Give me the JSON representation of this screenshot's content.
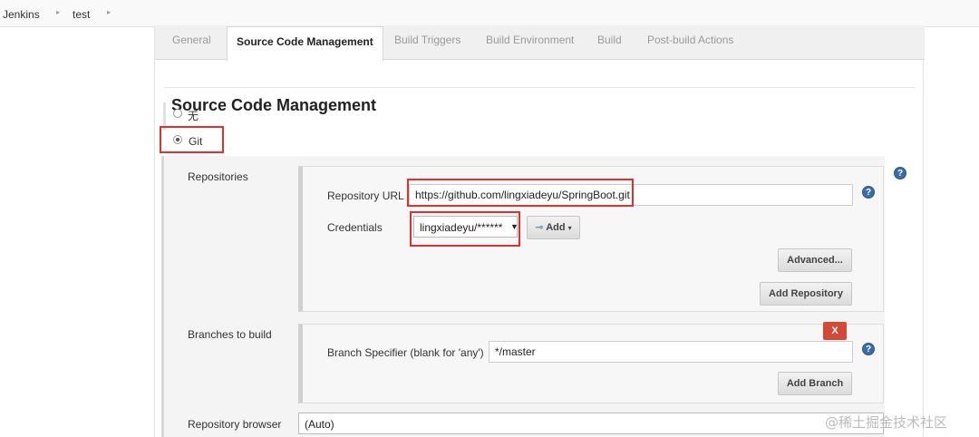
{
  "breadcrumb": {
    "items": [
      "Jenkins",
      "test"
    ]
  },
  "tabs": [
    "General",
    "Source Code Management",
    "Build Triggers",
    "Build Environment",
    "Build",
    "Post-build Actions"
  ],
  "active_tab": "Source Code Management",
  "section_title": "Source Code Management",
  "scm_options": [
    {
      "label": "无",
      "selected": false
    },
    {
      "label": "Git",
      "selected": true
    }
  ],
  "repositories": {
    "label": "Repositories",
    "url_label": "Repository URL",
    "url_value": "https://github.com/lingxiadeyu/SpringBoot.git",
    "credentials_label": "Credentials",
    "credentials_value": "lingxiadeyu/******",
    "add_button": "Add",
    "advanced_button": "Advanced...",
    "add_repository_button": "Add Repository"
  },
  "branches": {
    "label": "Branches to build",
    "delete_button": "X",
    "specifier_label": "Branch Specifier (blank for 'any')",
    "specifier_value": "*/master",
    "add_branch_button": "Add Branch"
  },
  "repository_browser": {
    "label": "Repository browser",
    "value": "(Auto)"
  },
  "help_icon_text": "?",
  "watermark": "@稀土掘金技术社区",
  "colors": {
    "highlight": "#e03030",
    "help_icon": "#3a6ea5",
    "delete_button": "#d24939"
  }
}
